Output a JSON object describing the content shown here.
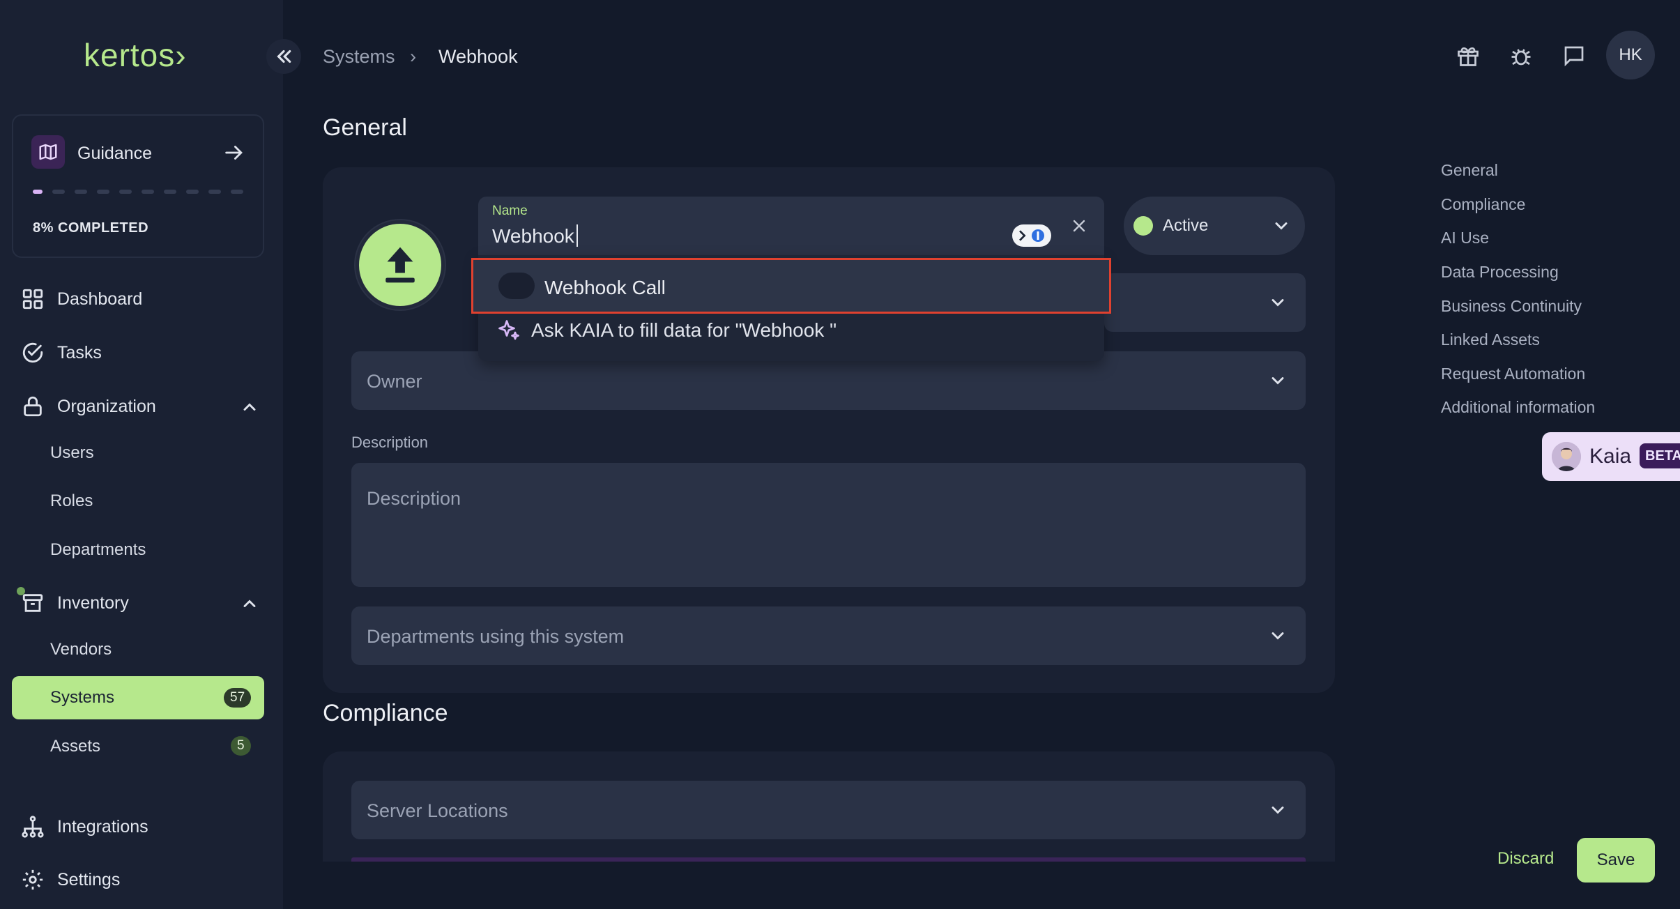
{
  "brand": {
    "logo_text": "kertos›",
    "accent_color": "#b6e88c"
  },
  "guidance": {
    "label": "Guidance",
    "progress_text": "8% COMPLETED",
    "progress_fraction": 0.08,
    "icon": "map-icon"
  },
  "sidebar": {
    "dashboard": "Dashboard",
    "tasks": "Tasks",
    "organization": "Organization",
    "users": "Users",
    "roles": "Roles",
    "departments": "Departments",
    "inventory": "Inventory",
    "vendors": "Vendors",
    "systems": "Systems",
    "systems_count": "57",
    "assets": "Assets",
    "assets_count": "5",
    "integrations": "Integrations",
    "settings": "Settings"
  },
  "breadcrumb": {
    "parent": "Systems",
    "separator": "›",
    "current": "Webhook"
  },
  "header": {
    "avatar_initials": "HK",
    "icons": [
      "gift-icon",
      "bug-icon",
      "chat-icon"
    ]
  },
  "sections": {
    "general": "General",
    "compliance": "Compliance"
  },
  "form": {
    "name_label": "Name",
    "name_value": "Webhook",
    "status_value": "Active",
    "owner_placeholder": "Owner",
    "description_label": "Description",
    "description_placeholder": "Description",
    "departments_placeholder": "Departments using this system",
    "server_locations_placeholder": "Server Locations"
  },
  "suggestions": {
    "option_1": "Webhook Call",
    "ai_option": "Ask KAIA to fill data for \"Webhook \""
  },
  "toc": [
    "General",
    "Compliance",
    "AI Use",
    "Data Processing",
    "Business Continuity",
    "Linked Assets",
    "Request Automation",
    "Additional information"
  ],
  "kaia": {
    "name": "Kaia",
    "badge": "BETA"
  },
  "actions": {
    "discard": "Discard",
    "save": "Save"
  }
}
